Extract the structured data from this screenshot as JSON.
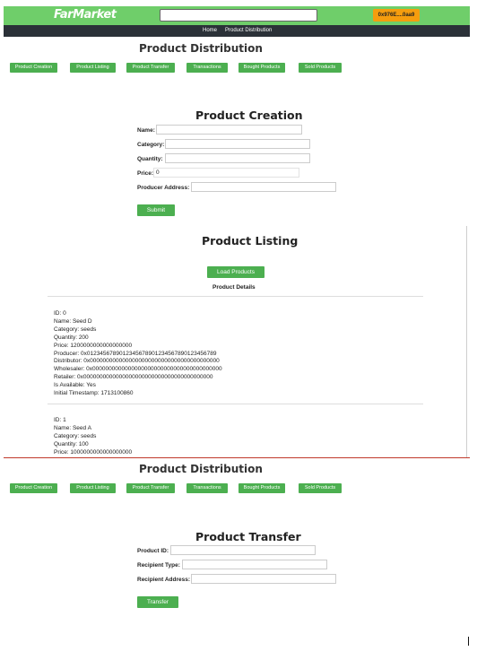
{
  "header": {
    "logo": "FarMarket",
    "search_placeholder": "",
    "wallet": "0x976E....0aa9"
  },
  "nav": {
    "home": "Home",
    "product_distribution": "Product Distribution"
  },
  "section_title": "Product Distribution",
  "tabs": [
    "Product Creation",
    "Product Listing",
    "Product Transfer",
    "Transactions",
    "Bought Products",
    "Sold Products"
  ],
  "creation": {
    "title": "Product Creation",
    "fields": {
      "name": {
        "label": "Name:",
        "value": ""
      },
      "category": {
        "label": "Category:",
        "value": ""
      },
      "quantity": {
        "label": "Quantity:",
        "value": ""
      },
      "price": {
        "label": "Price:",
        "value": "0"
      },
      "producer": {
        "label": "Producer Address:",
        "value": ""
      }
    },
    "submit": "Submit"
  },
  "listing": {
    "title": "Product Listing",
    "load_button": "Load Products",
    "details_title": "Product Details",
    "products": [
      {
        "lines": [
          "ID: 0",
          "Name: Seed D",
          "Category: seeds",
          "Quantity: 200",
          "Price: 1200000000000000000",
          "Producer: 0x0123456789012345678901234567890123456789",
          "Distributor: 0x0000000000000000000000000000000000000000",
          "Wholesaler: 0x0000000000000000000000000000000000000000",
          "Retailer: 0x0000000000000000000000000000000000000000",
          "Is Available: Yes",
          "Initial Timestamp: 1713100860"
        ]
      },
      {
        "lines": [
          "ID: 1",
          "Name: Seed A",
          "Category: seeds",
          "Quantity: 100",
          "Price: 1000000000000000000"
        ]
      }
    ]
  },
  "transfer": {
    "title": "Product Transfer",
    "fields": {
      "product_id": {
        "label": "Product ID:",
        "value": ""
      },
      "recipient_type": {
        "label": "Recipient Type:",
        "value": ""
      },
      "recipient_address": {
        "label": "Recipient Address:",
        "value": ""
      }
    },
    "button": "Transfer"
  },
  "colors": {
    "green": "#4caf50",
    "header_green": "#6fce6a",
    "navbar": "#2b3138",
    "wallet": "#f59d0e"
  }
}
